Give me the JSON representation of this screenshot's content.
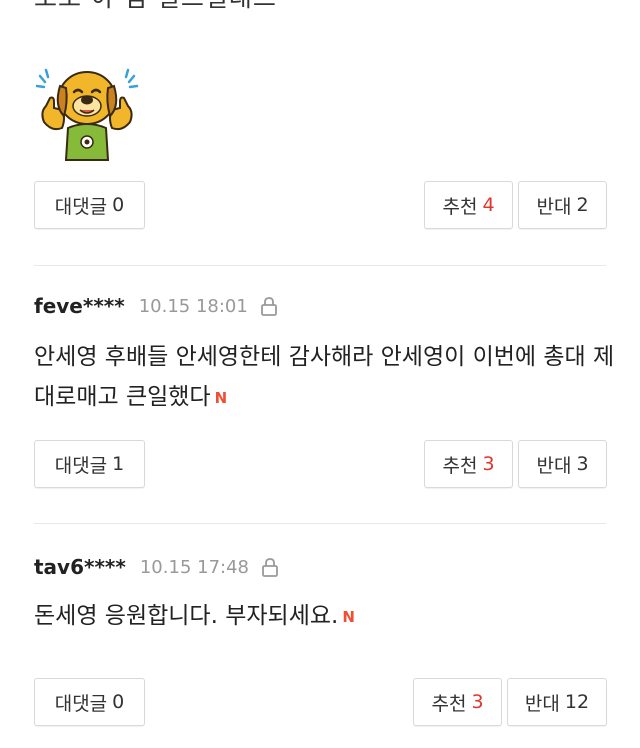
{
  "top_partial_text": "조오 야 점 일드일래드 ·",
  "comments": [
    {
      "reply_label": "대댓글",
      "reply_count": "0",
      "like_label": "추천",
      "like_count": "4",
      "dislike_label": "반대",
      "dislike_count": "2"
    },
    {
      "username": "feve****",
      "timestamp": "10.15 18:01",
      "text": "안세영 후배들 안세영한테 감사해라 안세영이 이번에 총대 제대로매고 큰일했다",
      "new_badge": "N",
      "reply_label": "대댓글",
      "reply_count": "1",
      "like_label": "추천",
      "like_count": "3",
      "dislike_label": "반대",
      "dislike_count": "3"
    },
    {
      "username": "tav6****",
      "timestamp": "10.15 17:48",
      "text": "돈세영 응원합니다. 부자되세요.",
      "new_badge": "N",
      "reply_label": "대댓글",
      "reply_count": "0",
      "like_label": "추천",
      "like_count": "3",
      "dislike_label": "반대",
      "dislike_count": "12"
    }
  ],
  "icons": {
    "emoticon": "thumbs-up-dog-emoticon",
    "lock": "lock-icon"
  },
  "colors": {
    "accent_red": "#e0362c",
    "new_badge": "#f04f33",
    "meta_gray": "#999999"
  }
}
